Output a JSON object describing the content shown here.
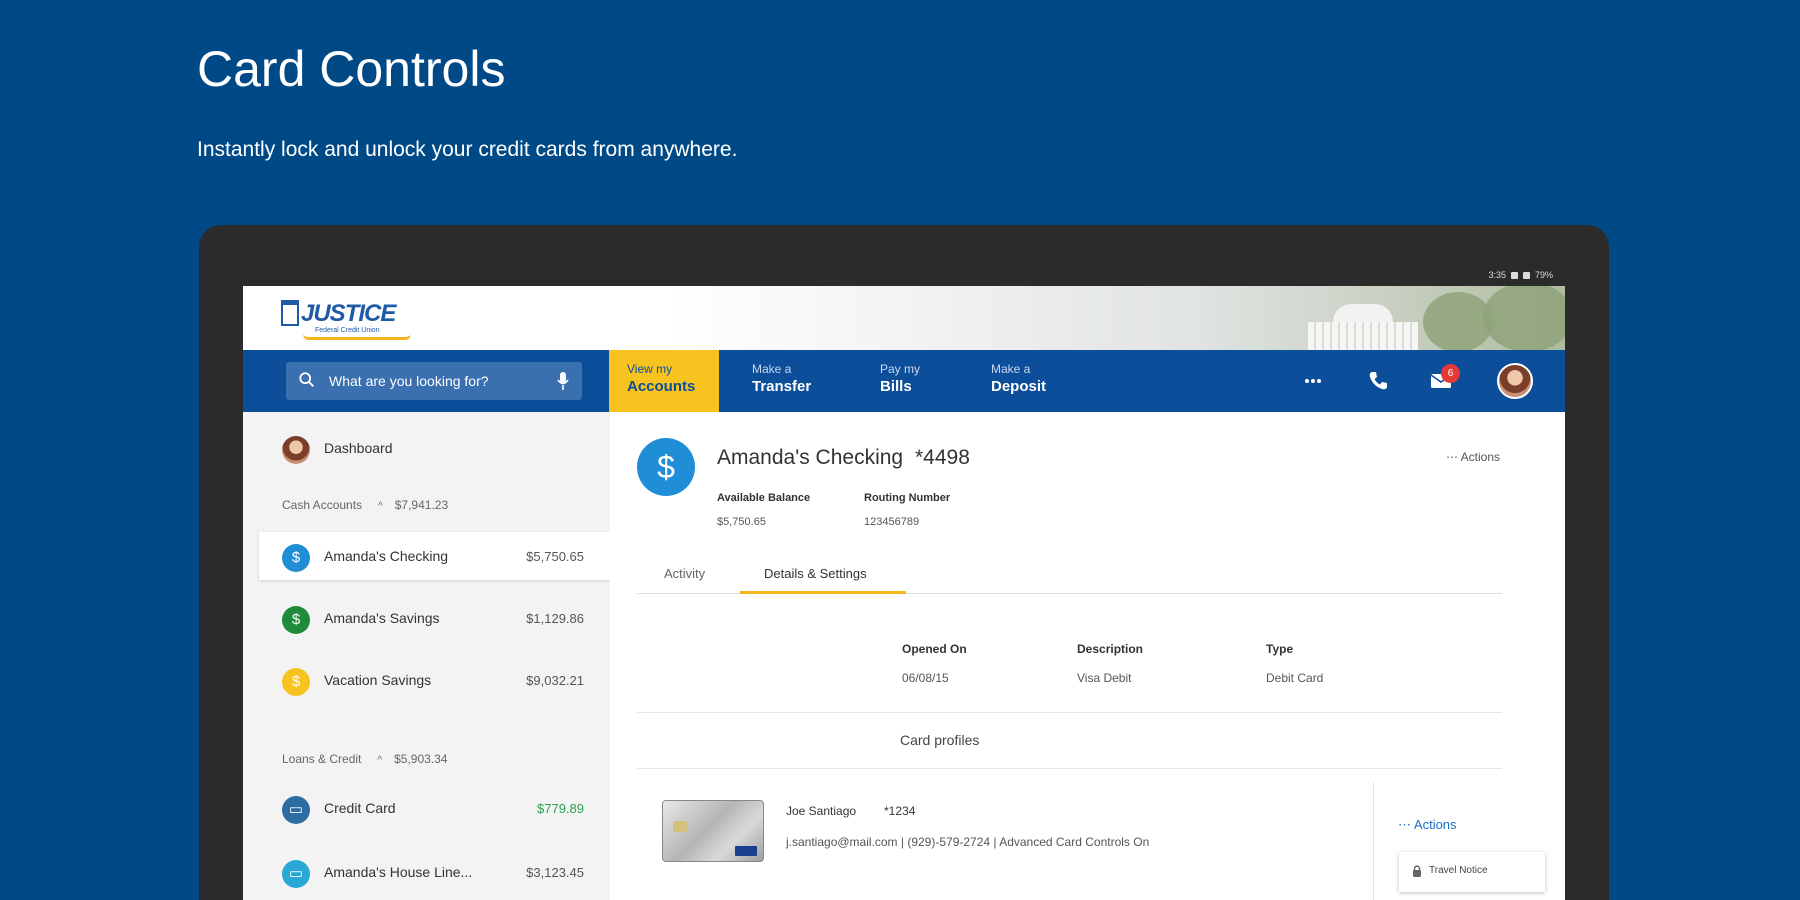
{
  "promo": {
    "title": "Card Controls",
    "subtitle": "Instantly lock and unlock your credit cards from anywhere."
  },
  "status_bar": {
    "time": "3:35",
    "battery": "79%"
  },
  "header": {
    "logo_text": "JUSTICE",
    "logo_subtext": "Federal Credit Union"
  },
  "nav": {
    "search_placeholder": "What are you looking for?",
    "items": [
      {
        "small": "View my",
        "big": "Accounts"
      },
      {
        "small": "Make a",
        "big": "Transfer"
      },
      {
        "small": "Pay my",
        "big": "Bills"
      },
      {
        "small": "Make a",
        "big": "Deposit"
      }
    ],
    "notification_count": "6"
  },
  "sidebar": {
    "dashboard_label": "Dashboard",
    "cash_accounts": {
      "label": "Cash Accounts",
      "total": "$7,941.23"
    },
    "accounts": [
      {
        "name": "Amanda's Checking",
        "amount": "$5,750.65",
        "color": "#1f8ed6"
      },
      {
        "name": "Amanda's Savings",
        "amount": "$1,129.86",
        "color": "#1e8a3a"
      },
      {
        "name": "Vacation Savings",
        "amount": "$9,032.21",
        "color": "#f7c31e"
      }
    ],
    "loans_credit": {
      "label": "Loans & Credit",
      "total": "$5,903.34"
    },
    "loans": [
      {
        "name": "Credit Card",
        "amount": "$779.89",
        "color": "#2e6da4",
        "amount_color": "#2e9e4f"
      },
      {
        "name": "Amanda's House Line...",
        "amount": "$3,123.45",
        "color": "#29a8d6",
        "amount_color": "#555555"
      }
    ]
  },
  "account": {
    "name": "Amanda's Checking",
    "number": "*4498",
    "actions_label": "Actions",
    "available_balance_label": "Available Balance",
    "available_balance": "$5,750.65",
    "routing_number_label": "Routing Number",
    "routing_number": "123456789",
    "tabs": [
      "Activity",
      "Details & Settings"
    ],
    "details": {
      "opened_on_label": "Opened On",
      "opened_on": "06/08/15",
      "description_label": "Description",
      "description": "Visa Debit",
      "type_label": "Type",
      "type": "Debit Card"
    },
    "card_profiles_label": "Card profiles",
    "card": {
      "holder": "Joe Santiago",
      "number": "*1234",
      "meta": "j.santiago@mail.com  |  (929)-579-2724  |  Advanced Card Controls On",
      "actions_label": "Actions",
      "menu_item": "Travel Notice"
    }
  },
  "colors": {
    "background": "#004987",
    "nav": "#0c4e9a",
    "accent": "#f7c31e",
    "link": "#1f6fc0"
  }
}
